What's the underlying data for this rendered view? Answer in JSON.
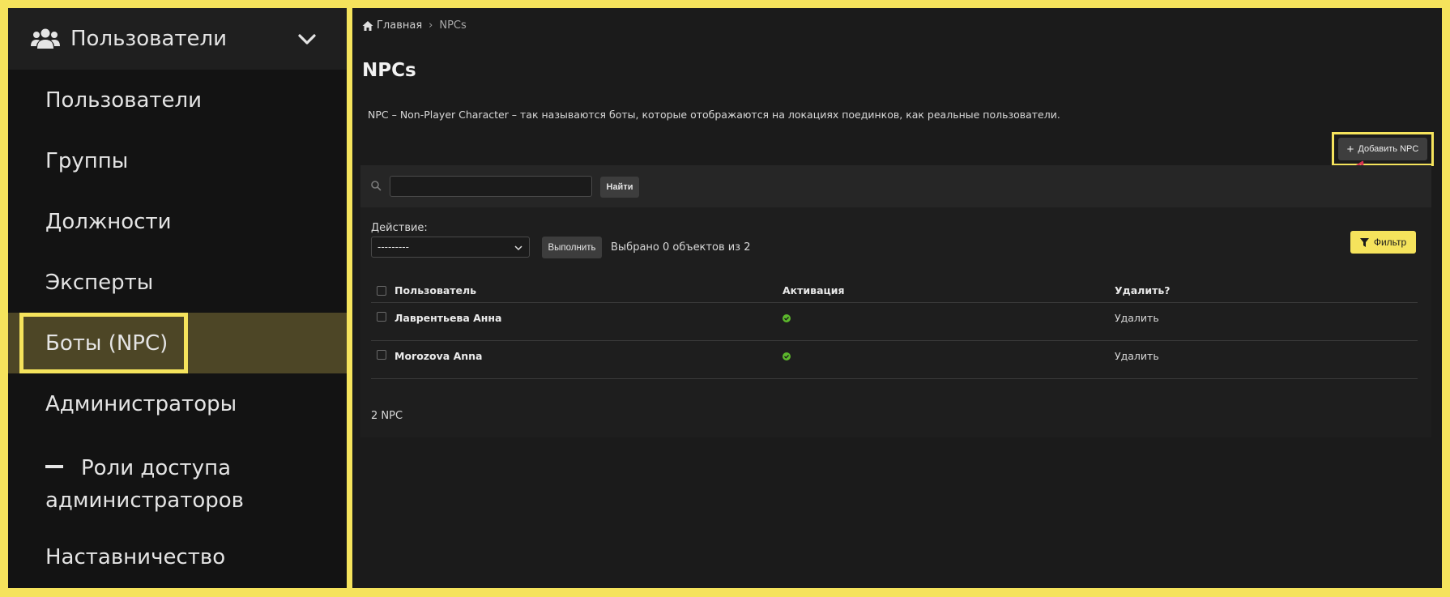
{
  "sidebar": {
    "section_title": "Пользователи",
    "items": [
      {
        "label": "Пользователи"
      },
      {
        "label": "Группы"
      },
      {
        "label": "Должности"
      },
      {
        "label": "Эксперты"
      },
      {
        "label": "Боты (NPC)",
        "active": true
      },
      {
        "label": "Администраторы"
      },
      {
        "label_line1": "Роли доступа",
        "label_line2": "администраторов"
      },
      {
        "label": "Наставничество"
      }
    ]
  },
  "breadcrumb": {
    "home": "Главная",
    "separator": "›",
    "current": "NPCs"
  },
  "page": {
    "title": "NPCs",
    "description": "NPC – Non-Player Character – так называются боты, которые отображаются на локациях поединков, как реальные пользователи.",
    "add_button": "Добавить NPC"
  },
  "search": {
    "value": "",
    "button": "Найти"
  },
  "actions": {
    "label": "Действие:",
    "selected_option": "---------",
    "execute_button": "Выполнить",
    "selected_text": "Выбрано 0 объектов из 2"
  },
  "filter_button": "Фильтр",
  "table": {
    "columns": {
      "user": "Пользователь",
      "activation": "Активация",
      "delete": "Удалить?"
    },
    "rows": [
      {
        "user": "Лаврентьева Анна",
        "active": true,
        "delete": "Удалить"
      },
      {
        "user": "Morozova Anna",
        "active": true,
        "delete": "Удалить"
      }
    ]
  },
  "footer_count": "2 NPC",
  "colors": {
    "accent": "#f5e35c",
    "active_item_bg": "#4d4626",
    "annotation_arrow": "#d8324f",
    "ok_green": "#5cb82c"
  }
}
